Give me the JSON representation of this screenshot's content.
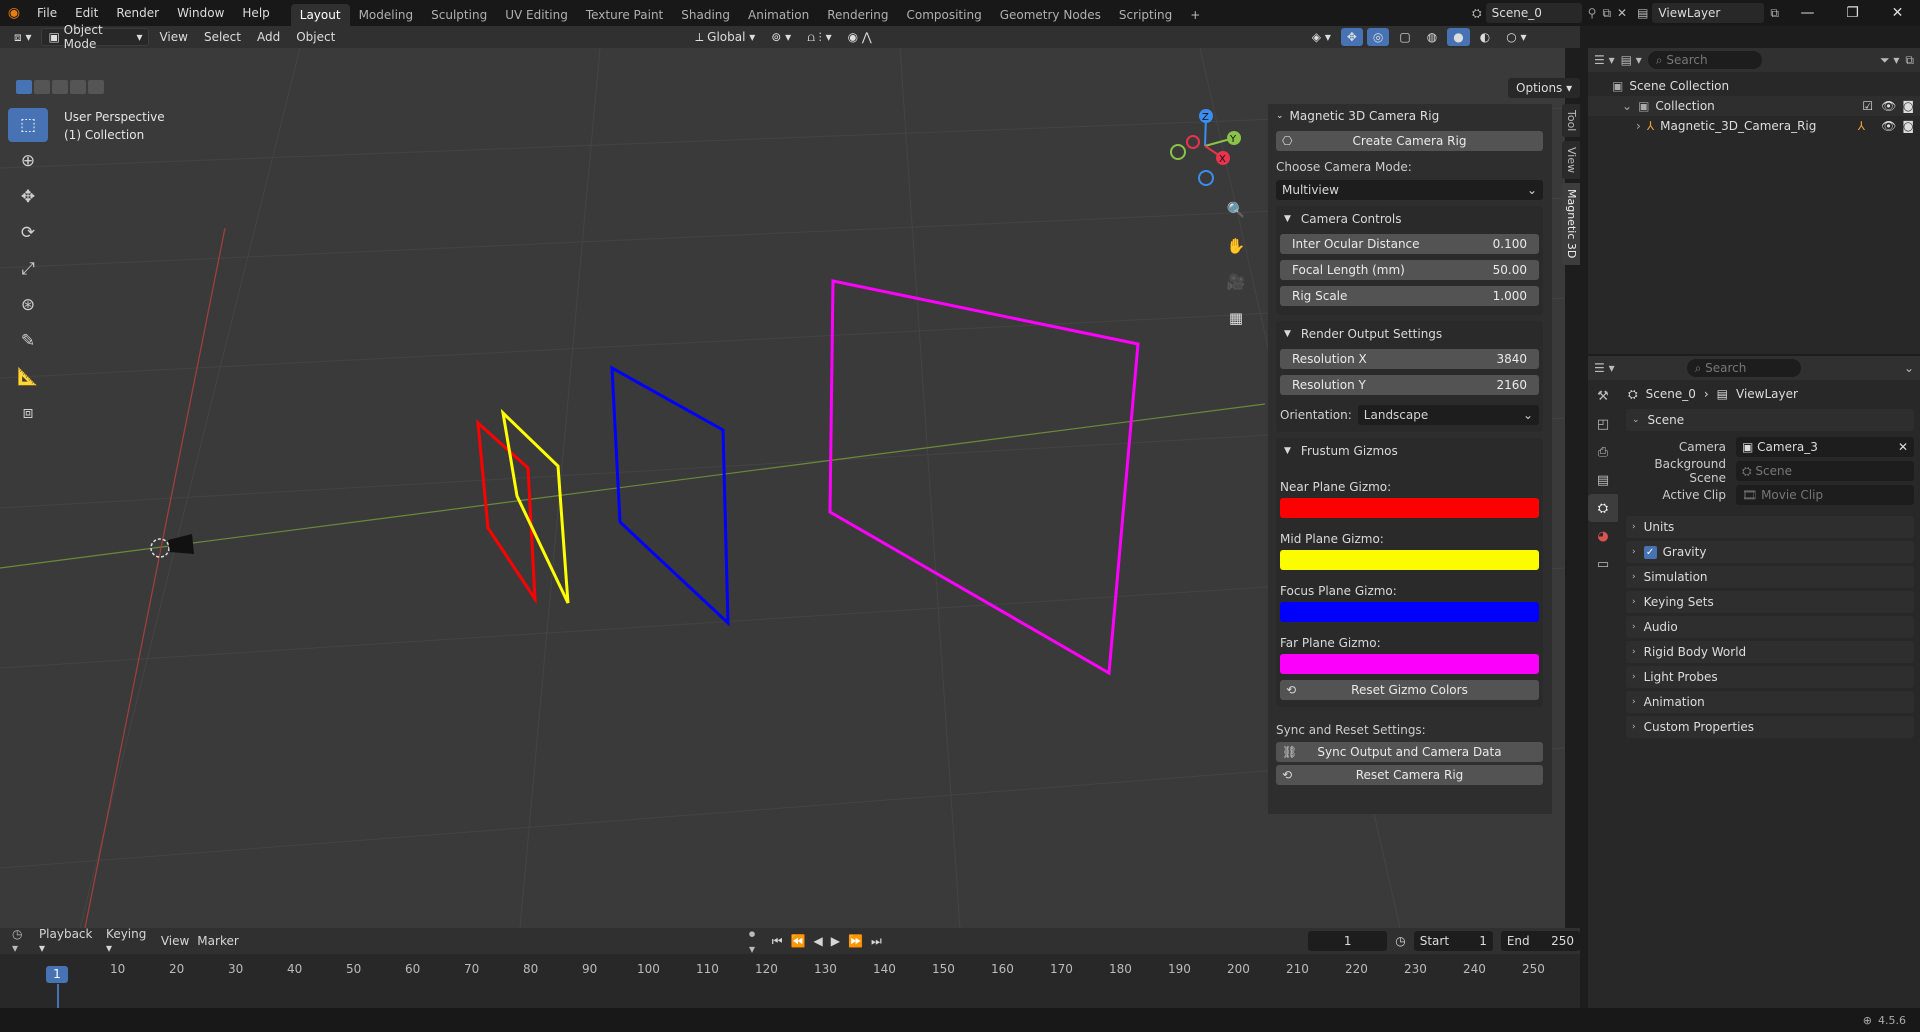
{
  "menubar": {
    "items": [
      "File",
      "Edit",
      "Render",
      "Window",
      "Help"
    ],
    "workspaces": [
      "Layout",
      "Modeling",
      "Sculpting",
      "UV Editing",
      "Texture Paint",
      "Shading",
      "Animation",
      "Rendering",
      "Compositing",
      "Geometry Nodes",
      "Scripting"
    ],
    "active_workspace": "Layout",
    "scene": "Scene_0",
    "view_layer": "ViewLayer"
  },
  "viewport_header": {
    "mode": "Object Mode",
    "menus": [
      "View",
      "Select",
      "Add",
      "Object"
    ],
    "transform": "Global",
    "options": "Options"
  },
  "viewport": {
    "perspective": "User Perspective",
    "collection": "(1) Collection"
  },
  "gizmo": {
    "x": "X",
    "y": "Y",
    "z": "Z",
    "colors": {
      "x": "#e8344d",
      "y": "#8bc34a",
      "z": "#3b8ef0"
    }
  },
  "npanel": {
    "title": "Magnetic 3D Camera Rig",
    "create_button": "Create Camera Rig",
    "mode_label": "Choose Camera Mode:",
    "mode_value": "Multiview",
    "camera_controls": {
      "title": "Camera Controls",
      "rows": [
        {
          "label": "Inter Ocular Distance",
          "value": "0.100"
        },
        {
          "label": "Focal Length (mm)",
          "value": "50.00"
        },
        {
          "label": "Rig Scale",
          "value": "1.000"
        }
      ]
    },
    "render_output": {
      "title": "Render Output Settings",
      "rows": [
        {
          "label": "Resolution X",
          "value": "3840"
        },
        {
          "label": "Resolution Y",
          "value": "2160"
        }
      ],
      "orientation_label": "Orientation:",
      "orientation_value": "Landscape"
    },
    "frustum": {
      "title": "Frustum Gizmos",
      "swatches": [
        {
          "label": "Near Plane Gizmo:",
          "color": "#ff0000"
        },
        {
          "label": "Mid Plane Gizmo:",
          "color": "#ffff00"
        },
        {
          "label": "Focus Plane Gizmo:",
          "color": "#0000ff"
        },
        {
          "label": "Far Plane Gizmo:",
          "color": "#ff00ff"
        }
      ],
      "reset_button": "Reset Gizmo Colors"
    },
    "sync_label": "Sync and Reset Settings:",
    "sync_button": "Sync Output and Camera Data",
    "reset_rig_button": "Reset Camera Rig",
    "tabs": [
      "Tool",
      "View",
      "Magnetic 3D"
    ]
  },
  "outliner": {
    "search_placeholder": "Search",
    "root": "Scene Collection",
    "collection": "Collection",
    "object": "Magnetic_3D_Camera_Rig"
  },
  "properties": {
    "search_placeholder": "Search",
    "breadcrumb_scene": "Scene_0",
    "breadcrumb_layer": "ViewLayer",
    "scene_section": "Scene",
    "camera_label": "Camera",
    "camera_value": "Camera_3",
    "bg_label": "Background Scene",
    "bg_placeholder": "Scene",
    "clip_label": "Active Clip",
    "clip_placeholder": "Movie Clip",
    "sections": [
      "Units",
      "Gravity",
      "Simulation",
      "Keying Sets",
      "Audio",
      "Rigid Body World",
      "Light Probes",
      "Animation",
      "Custom Properties"
    ]
  },
  "timeline": {
    "menus": [
      "Playback",
      "Keying",
      "View",
      "Marker"
    ],
    "current_frame": "1",
    "start_label": "Start",
    "start": "1",
    "end_label": "End",
    "end": "250",
    "ticks": [
      "1",
      "10",
      "20",
      "30",
      "40",
      "50",
      "60",
      "70",
      "80",
      "90",
      "100",
      "110",
      "120",
      "130",
      "140",
      "150",
      "160",
      "170",
      "180",
      "190",
      "200",
      "210",
      "220",
      "230",
      "240",
      "250"
    ]
  },
  "status": {
    "version": "4.5.6"
  }
}
